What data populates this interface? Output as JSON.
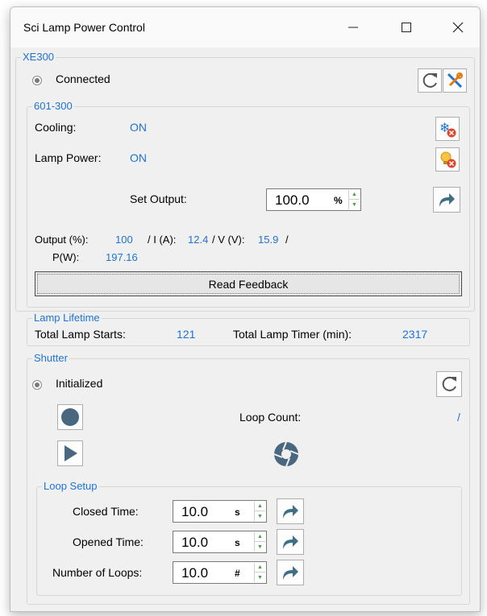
{
  "window": {
    "title": "Sci Lamp Power Control"
  },
  "xe300": {
    "legend": "XE300",
    "status": "Connected",
    "icons": {
      "refresh": "refresh-icon",
      "settings": "tools-icon"
    }
  },
  "controller": {
    "legend": "601-300",
    "cooling_label": "Cooling:",
    "cooling_value": "ON",
    "lamp_power_label": "Lamp Power:",
    "lamp_power_value": "ON",
    "set_output_label": "Set Output:",
    "set_output_value": "100.0",
    "set_output_unit": "%",
    "output_label": "Output (%):",
    "output_value": "100",
    "current_label": "/ I (A):",
    "current_value": "12.4",
    "voltage_label": "/ V (V):",
    "voltage_value": "15.9",
    "slash": "/",
    "power_label": "P(W):",
    "power_value": "197.16",
    "read_feedback": "Read Feedback"
  },
  "lifetime": {
    "legend": "Lamp Lifetime",
    "starts_label": "Total Lamp Starts:",
    "starts_value": "121",
    "timer_label": "Total Lamp Timer (min):",
    "timer_value": "2317"
  },
  "shutter": {
    "legend": "Shutter",
    "status": "Initialized",
    "loop_count_label": "Loop Count:",
    "loop_count_value": "/"
  },
  "loop_setup": {
    "legend": "Loop Setup",
    "closed_label": "Closed Time:",
    "closed_value": "10.0",
    "closed_unit": "s",
    "opened_label": "Opened Time:",
    "opened_value": "10.0",
    "opened_unit": "s",
    "loops_label": "Number of Loops:",
    "loops_value": "10.0",
    "loops_unit": "#"
  },
  "colors": {
    "accent": "#1e73d6",
    "arrow": "#3f6f86"
  }
}
